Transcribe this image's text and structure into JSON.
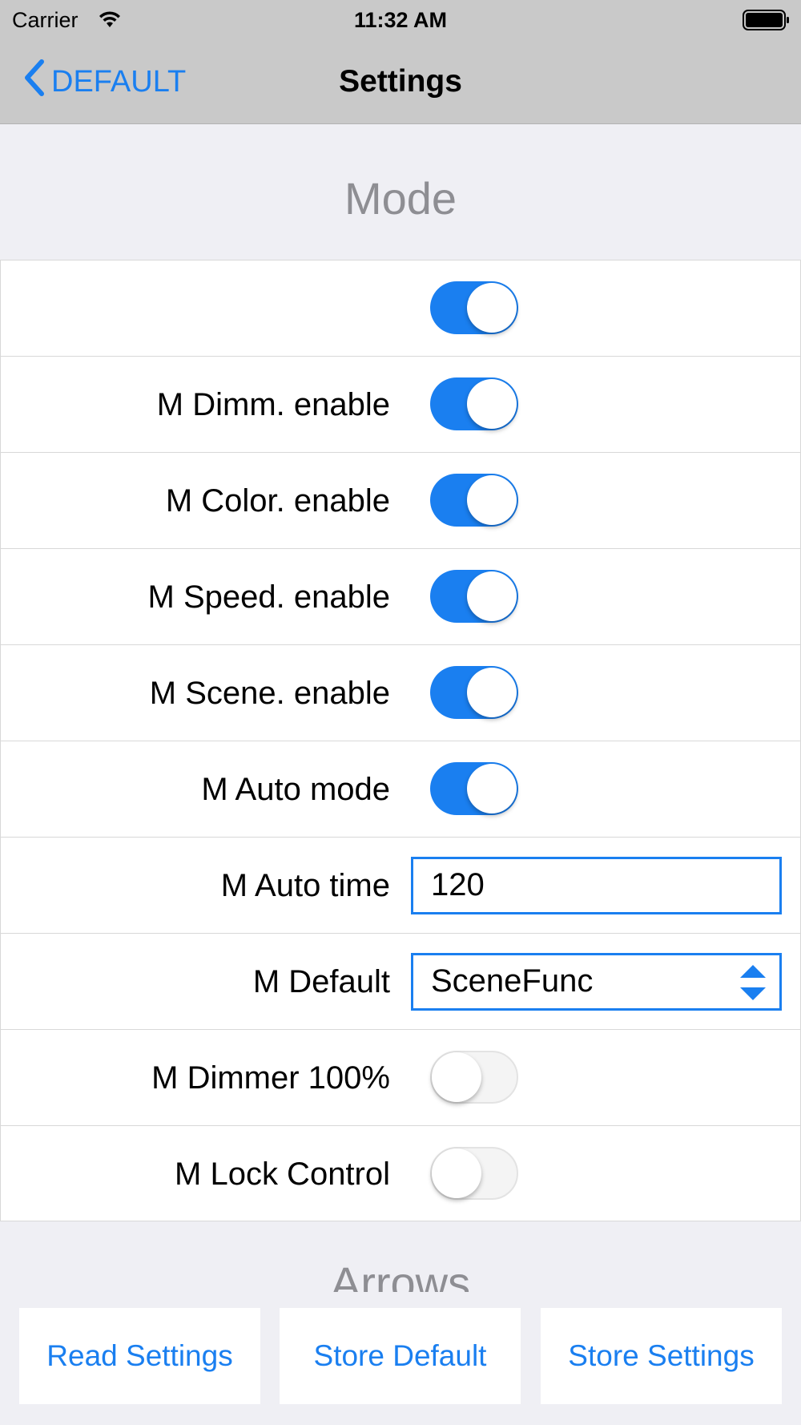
{
  "status_bar": {
    "carrier": "Carrier",
    "time": "11:32 AM",
    "icons": [
      "wifi-icon",
      "battery-icon"
    ]
  },
  "nav": {
    "back_label": "DEFAULT",
    "back_icon": "chevron-left-icon",
    "title": "Settings"
  },
  "section_mode": {
    "title": "Mode",
    "rows": [
      {
        "label": "",
        "control": "toggle",
        "on": true
      },
      {
        "label": "M Dimm. enable",
        "control": "toggle",
        "on": true
      },
      {
        "label": "M Color. enable",
        "control": "toggle",
        "on": true
      },
      {
        "label": "M Speed. enable",
        "control": "toggle",
        "on": true
      },
      {
        "label": "M Scene. enable",
        "control": "toggle",
        "on": true
      },
      {
        "label": "M Auto mode",
        "control": "toggle",
        "on": true
      },
      {
        "label": "M Auto time",
        "control": "text",
        "value": "120"
      },
      {
        "label": "M Default",
        "control": "select",
        "value": "SceneFunc"
      },
      {
        "label": "M Dimmer 100%",
        "control": "toggle",
        "on": false
      },
      {
        "label": "M Lock Control",
        "control": "toggle",
        "on": false
      }
    ]
  },
  "section_arrows": {
    "title": "Arrows"
  },
  "buttons": {
    "read_settings": "Read Settings",
    "store_default": "Store Default",
    "store_settings": "Store Settings"
  },
  "colors": {
    "accent": "#1a7ff0",
    "bar_background": "#c9c9c9",
    "page_background": "#efeff4",
    "section_header": "#8e8e93"
  }
}
